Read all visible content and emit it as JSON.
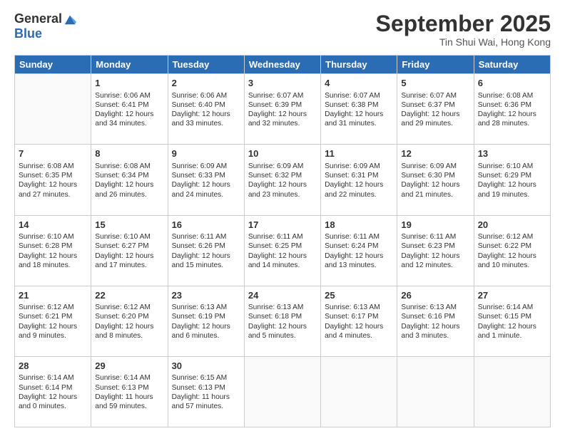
{
  "logo": {
    "general": "General",
    "blue": "Blue"
  },
  "title": "September 2025",
  "location": "Tin Shui Wai, Hong Kong",
  "days": [
    "Sunday",
    "Monday",
    "Tuesday",
    "Wednesday",
    "Thursday",
    "Friday",
    "Saturday"
  ],
  "weeks": [
    [
      {
        "day": "",
        "content": ""
      },
      {
        "day": "1",
        "content": "Sunrise: 6:06 AM\nSunset: 6:41 PM\nDaylight: 12 hours\nand 34 minutes."
      },
      {
        "day": "2",
        "content": "Sunrise: 6:06 AM\nSunset: 6:40 PM\nDaylight: 12 hours\nand 33 minutes."
      },
      {
        "day": "3",
        "content": "Sunrise: 6:07 AM\nSunset: 6:39 PM\nDaylight: 12 hours\nand 32 minutes."
      },
      {
        "day": "4",
        "content": "Sunrise: 6:07 AM\nSunset: 6:38 PM\nDaylight: 12 hours\nand 31 minutes."
      },
      {
        "day": "5",
        "content": "Sunrise: 6:07 AM\nSunset: 6:37 PM\nDaylight: 12 hours\nand 29 minutes."
      },
      {
        "day": "6",
        "content": "Sunrise: 6:08 AM\nSunset: 6:36 PM\nDaylight: 12 hours\nand 28 minutes."
      }
    ],
    [
      {
        "day": "7",
        "content": "Sunrise: 6:08 AM\nSunset: 6:35 PM\nDaylight: 12 hours\nand 27 minutes."
      },
      {
        "day": "8",
        "content": "Sunrise: 6:08 AM\nSunset: 6:34 PM\nDaylight: 12 hours\nand 26 minutes."
      },
      {
        "day": "9",
        "content": "Sunrise: 6:09 AM\nSunset: 6:33 PM\nDaylight: 12 hours\nand 24 minutes."
      },
      {
        "day": "10",
        "content": "Sunrise: 6:09 AM\nSunset: 6:32 PM\nDaylight: 12 hours\nand 23 minutes."
      },
      {
        "day": "11",
        "content": "Sunrise: 6:09 AM\nSunset: 6:31 PM\nDaylight: 12 hours\nand 22 minutes."
      },
      {
        "day": "12",
        "content": "Sunrise: 6:09 AM\nSunset: 6:30 PM\nDaylight: 12 hours\nand 21 minutes."
      },
      {
        "day": "13",
        "content": "Sunrise: 6:10 AM\nSunset: 6:29 PM\nDaylight: 12 hours\nand 19 minutes."
      }
    ],
    [
      {
        "day": "14",
        "content": "Sunrise: 6:10 AM\nSunset: 6:28 PM\nDaylight: 12 hours\nand 18 minutes."
      },
      {
        "day": "15",
        "content": "Sunrise: 6:10 AM\nSunset: 6:27 PM\nDaylight: 12 hours\nand 17 minutes."
      },
      {
        "day": "16",
        "content": "Sunrise: 6:11 AM\nSunset: 6:26 PM\nDaylight: 12 hours\nand 15 minutes."
      },
      {
        "day": "17",
        "content": "Sunrise: 6:11 AM\nSunset: 6:25 PM\nDaylight: 12 hours\nand 14 minutes."
      },
      {
        "day": "18",
        "content": "Sunrise: 6:11 AM\nSunset: 6:24 PM\nDaylight: 12 hours\nand 13 minutes."
      },
      {
        "day": "19",
        "content": "Sunrise: 6:11 AM\nSunset: 6:23 PM\nDaylight: 12 hours\nand 12 minutes."
      },
      {
        "day": "20",
        "content": "Sunrise: 6:12 AM\nSunset: 6:22 PM\nDaylight: 12 hours\nand 10 minutes."
      }
    ],
    [
      {
        "day": "21",
        "content": "Sunrise: 6:12 AM\nSunset: 6:21 PM\nDaylight: 12 hours\nand 9 minutes."
      },
      {
        "day": "22",
        "content": "Sunrise: 6:12 AM\nSunset: 6:20 PM\nDaylight: 12 hours\nand 8 minutes."
      },
      {
        "day": "23",
        "content": "Sunrise: 6:13 AM\nSunset: 6:19 PM\nDaylight: 12 hours\nand 6 minutes."
      },
      {
        "day": "24",
        "content": "Sunrise: 6:13 AM\nSunset: 6:18 PM\nDaylight: 12 hours\nand 5 minutes."
      },
      {
        "day": "25",
        "content": "Sunrise: 6:13 AM\nSunset: 6:17 PM\nDaylight: 12 hours\nand 4 minutes."
      },
      {
        "day": "26",
        "content": "Sunrise: 6:13 AM\nSunset: 6:16 PM\nDaylight: 12 hours\nand 3 minutes."
      },
      {
        "day": "27",
        "content": "Sunrise: 6:14 AM\nSunset: 6:15 PM\nDaylight: 12 hours\nand 1 minute."
      }
    ],
    [
      {
        "day": "28",
        "content": "Sunrise: 6:14 AM\nSunset: 6:14 PM\nDaylight: 12 hours\nand 0 minutes."
      },
      {
        "day": "29",
        "content": "Sunrise: 6:14 AM\nSunset: 6:13 PM\nDaylight: 11 hours\nand 59 minutes."
      },
      {
        "day": "30",
        "content": "Sunrise: 6:15 AM\nSunset: 6:13 PM\nDaylight: 11 hours\nand 57 minutes."
      },
      {
        "day": "",
        "content": ""
      },
      {
        "day": "",
        "content": ""
      },
      {
        "day": "",
        "content": ""
      },
      {
        "day": "",
        "content": ""
      }
    ]
  ]
}
